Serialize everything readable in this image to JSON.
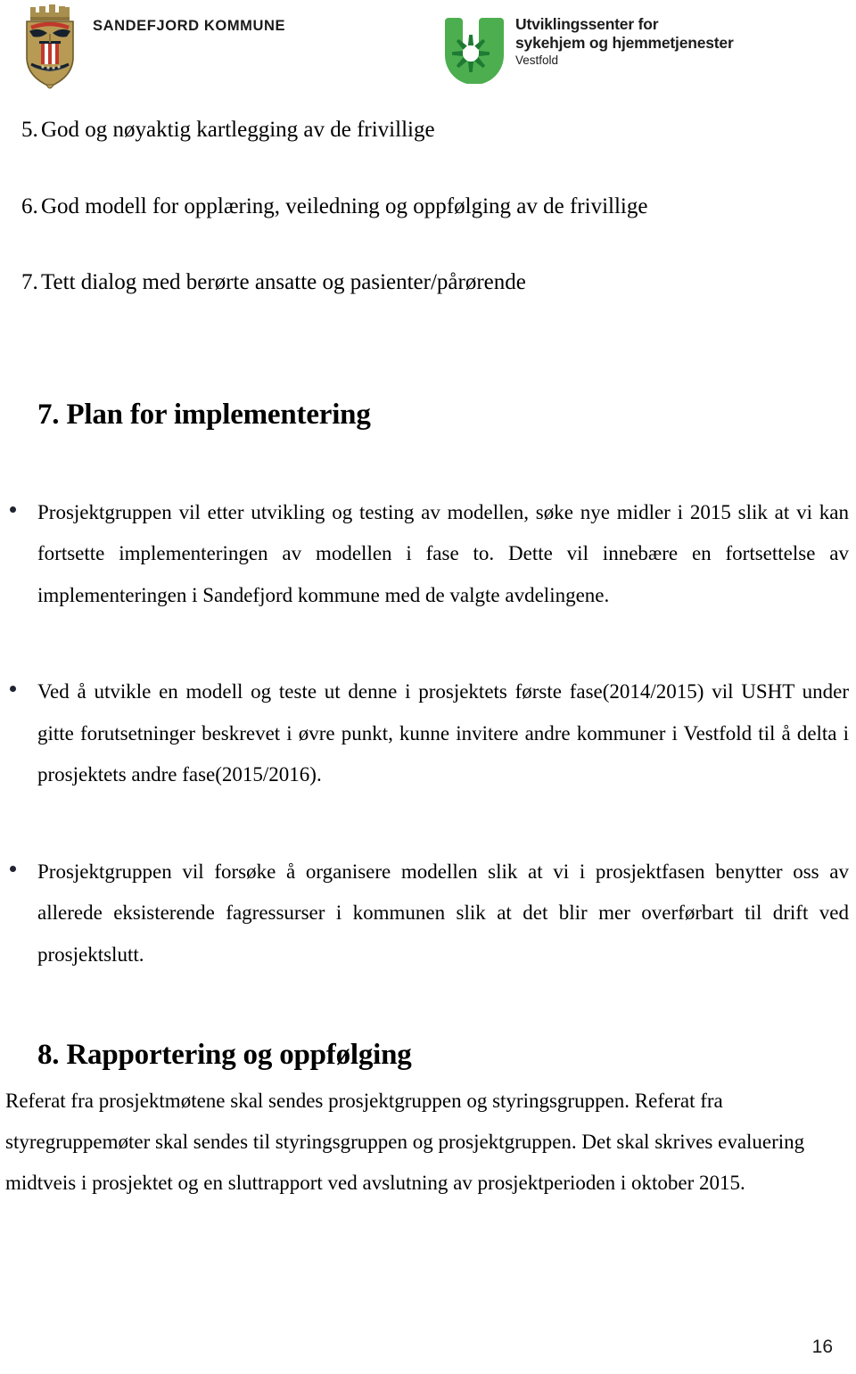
{
  "header": {
    "kommune_wordmark": "SANDEFJORD KOMMUNE",
    "crest_alt": "sandefjord-coat-of-arms",
    "usht": {
      "line1": "Utviklingssenter for",
      "line2": "sykehjem og hjemmetjenester",
      "line3": "Vestfold",
      "logo_alt": "usht-u-logo"
    },
    "colors": {
      "usht_green": "#4CAE4F",
      "usht_green_dark": "#2E7D32",
      "crest_gold": "#B89A52",
      "crest_red": "#C0392B",
      "crest_navy": "#1C2B3A"
    }
  },
  "numbered_list": [
    {
      "number": "5.",
      "text": "God og nøyaktig kartlegging av de frivillige"
    },
    {
      "number": "6.",
      "text": "God modell for opplæring, veiledning og oppfølging av de frivillige"
    },
    {
      "number": "7.",
      "text": "Tett dialog med berørte ansatte og pasienter/pårørende"
    }
  ],
  "section_7": {
    "heading": "7. Plan for implementering",
    "bullets": [
      "Prosjektgruppen vil etter utvikling og testing av modellen, søke nye midler i 2015 slik at vi kan fortsette implementeringen av modellen i fase to. Dette vil innebære en fortsettelse av implementeringen i Sandefjord kommune med de valgte avdelingene.",
      "Ved å utvikle en modell og teste ut denne i prosjektets første fase(2014/2015) vil USHT under gitte forutsetninger beskrevet i øvre punkt,  kunne invitere andre kommuner i Vestfold til å delta i prosjektets andre fase(2015/2016).",
      "Prosjektgruppen vil forsøke å organisere modellen slik at vi i prosjektfasen benytter oss av allerede eksisterende fagressurser i kommunen slik at det blir mer overførbart til drift ved prosjektslutt."
    ]
  },
  "section_8": {
    "heading": "8. Rapportering og oppfølging",
    "paragraph": "Referat fra prosjektmøtene skal sendes prosjektgruppen og styringsgruppen. Referat fra styregruppemøter skal sendes til styringsgruppen og prosjektgruppen. Det skal skrives evaluering midtveis i prosjektet og en sluttrapport ved avslutning av prosjektperioden i oktober 2015."
  },
  "footer": {
    "page_number": "16"
  }
}
